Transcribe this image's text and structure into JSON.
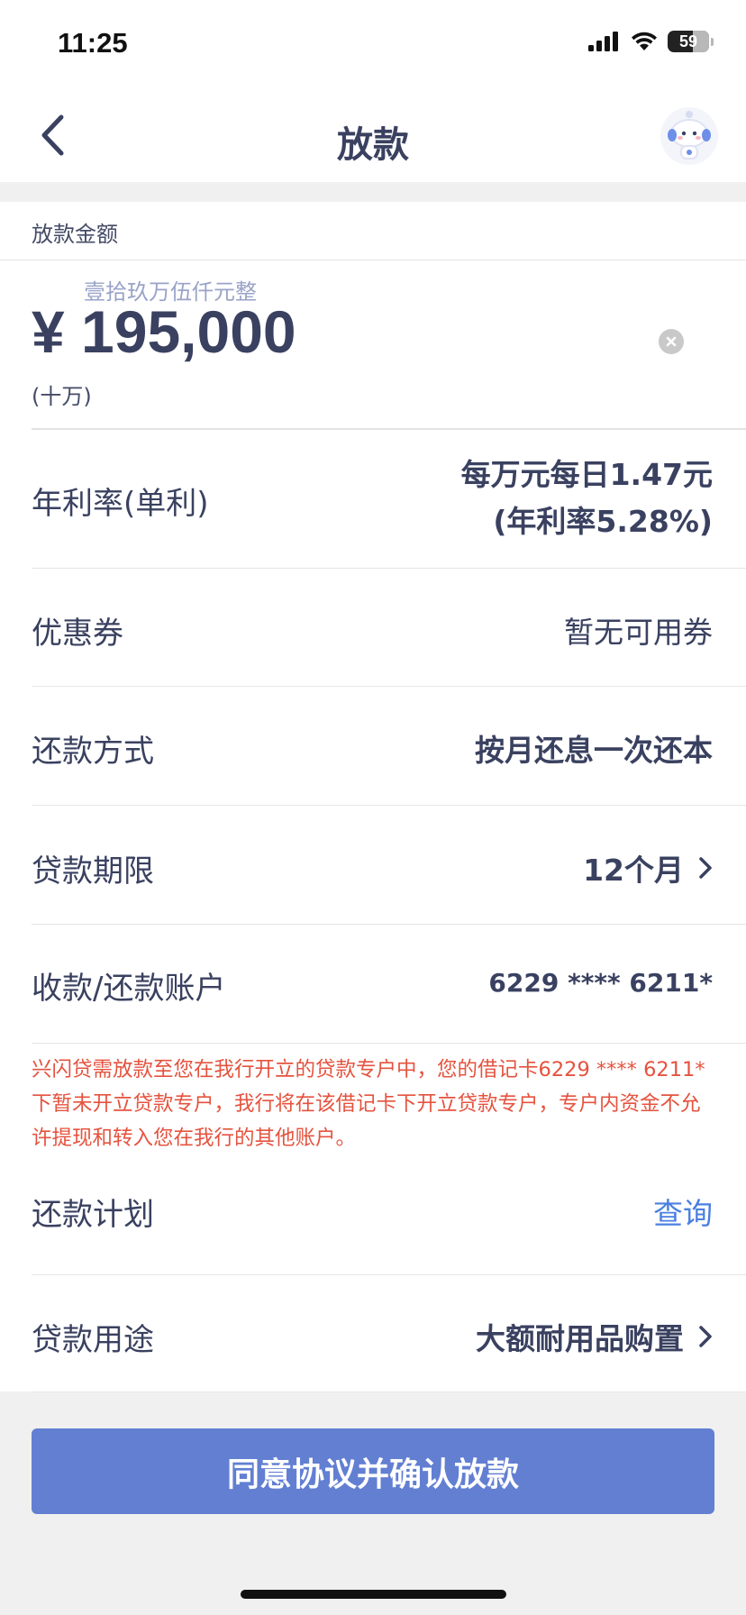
{
  "status_bar": {
    "time": "11:25",
    "battery": "59"
  },
  "nav": {
    "title": "放款"
  },
  "amount_section": {
    "label": "放款金额",
    "amount_in_words": "壹拾玖万伍仟元整",
    "amount": "¥ 195,000",
    "unit_hint": "(十万)"
  },
  "rows": {
    "rate": {
      "label": "年利率(单利)",
      "value_line1": "每万元每日1.47元",
      "value_line2": "(年利率5.28%)"
    },
    "coupon": {
      "label": "优惠券",
      "value": "暂无可用券"
    },
    "repay_method": {
      "label": "还款方式",
      "value": "按月还息一次还本"
    },
    "term": {
      "label": "贷款期限",
      "value": "12个月"
    },
    "account": {
      "label": "收款/还款账户",
      "value": "6229 **** 6211*"
    },
    "repay_plan": {
      "label": "还款计划",
      "value": "查询"
    },
    "purpose": {
      "label": "贷款用途",
      "value": "大额耐用品购置"
    }
  },
  "notice": "兴闪贷需放款至您在我行开立的贷款专户中，您的借记卡6229 **** 6211*下暂未开立贷款专户，我行将在该借记卡下开立贷款专户，专户内资金不允许提现和转入您在我行的其他账户。",
  "confirm_button": "同意协议并确认放款",
  "colors": {
    "accent": "#627fd2",
    "link": "#4a7fe0",
    "warning": "#e5533f",
    "text": "#3a4160"
  }
}
